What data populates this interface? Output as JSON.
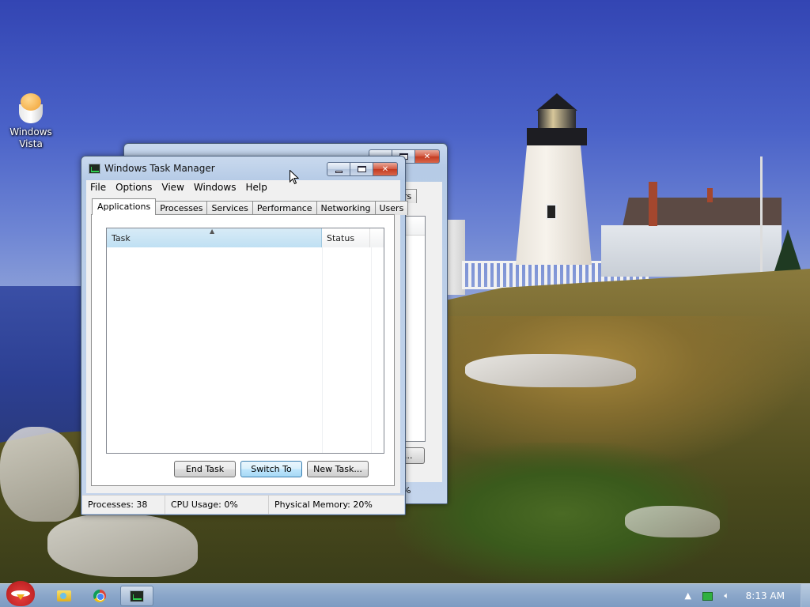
{
  "desktop": {
    "icon_label_line1": "Windows",
    "icon_label_line2": "Vista"
  },
  "back_window": {
    "tab_tail": "rs",
    "button_tail": "...",
    "status_tail": "%"
  },
  "task_manager": {
    "title": "Windows Task Manager",
    "menu": [
      "File",
      "Options",
      "View",
      "Windows",
      "Help"
    ],
    "tabs": [
      "Applications",
      "Processes",
      "Services",
      "Performance",
      "Networking",
      "Users"
    ],
    "active_tab": "Applications",
    "columns": [
      "Task",
      "Status"
    ],
    "rows": [],
    "buttons": {
      "end_task": "End Task",
      "switch_to": "Switch To",
      "new_task": "New Task..."
    },
    "status": {
      "processes": "Processes: 38",
      "cpu": "CPU Usage: 0%",
      "memory": "Physical Memory: 20%"
    }
  },
  "taskbar": {
    "clock": "8:13 AM",
    "items": [
      "start-orb",
      "windows-explorer",
      "google-chrome",
      "task-manager"
    ]
  },
  "colors": {
    "taskbar": "#8aa6c9",
    "window_frame": "#b6cbe6",
    "close_button": "#c23a20",
    "sorted_column": "#bfe0f3"
  }
}
